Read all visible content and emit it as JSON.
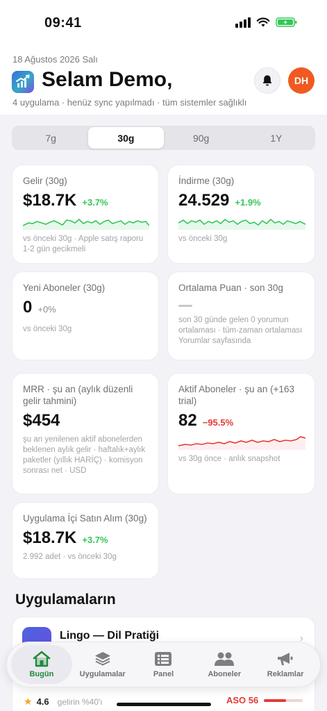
{
  "status_bar": {
    "time": "09:41"
  },
  "header": {
    "date": "18 Ağustos 2026 Salı",
    "greeting": "Selam Demo,",
    "subline": "4 uygulama · henüz sync yapılmadı · tüm sistemler sağlıklı",
    "avatar_initials": "DH"
  },
  "period_tabs": [
    {
      "label": "7g",
      "active": false
    },
    {
      "label": "30g",
      "active": true
    },
    {
      "label": "90g",
      "active": false
    },
    {
      "label": "1Y",
      "active": false
    }
  ],
  "cards": {
    "revenue": {
      "title": "Gelir (30g)",
      "value": "$18.7K",
      "delta": "+3.7%",
      "note": "vs önceki 30g · Apple satış raporu 1-2 gün gecikmeli"
    },
    "downloads": {
      "title": "İndirme (30g)",
      "value": "24.529",
      "delta": "+1.9%",
      "note": "vs önceki 30g"
    },
    "new_subs": {
      "title": "Yeni Aboneler (30g)",
      "value": "0",
      "delta": "+0%",
      "note": "vs önceki 30g"
    },
    "rating": {
      "title": "Ortalama Puan · son 30g",
      "note": "son 30 günde gelen 0 yorumun ortalaması · tüm-zaman ortalaması Yorumlar sayfasında"
    },
    "mrr": {
      "title": "MRR · şu an (aylık düzenli gelir tahmini)",
      "value": "$454",
      "note": "şu an yenilenen aktif abonelerden beklenen aylık gelir · haftalık+aylık paketler (yıllık HARİÇ) · komisyon sonrası net · USD"
    },
    "active_subs": {
      "title": "Aktif Aboneler · şu an (+163 trial)",
      "value": "82",
      "delta": "−95.5%",
      "note": "vs 30g önce · anlık snapshot"
    },
    "iap": {
      "title": "Uygulama İçi Satın Alım (30g)",
      "value": "$18.7K",
      "delta": "+3.7%",
      "note": "2.992 adet · vs önceki 30g"
    }
  },
  "colors": {
    "up": "#34c759",
    "down": "#e53935",
    "accent_orange": "#f05a22",
    "active_tab": "#1f8a3a"
  },
  "section": {
    "apps_title": "Uygulamaların"
  },
  "app_card": {
    "name": "Lingo — Dil Pratiği",
    "rating": "4.6",
    "rating_sub": "gelirin %40'ı",
    "aso_label": "ASO 56",
    "aso_score": 56
  },
  "tabbar": [
    {
      "label": "Bugün",
      "icon": "home-icon",
      "active": true
    },
    {
      "label": "Uygulamalar",
      "icon": "layers-icon",
      "active": false
    },
    {
      "label": "Panel",
      "icon": "panel-icon",
      "active": false
    },
    {
      "label": "Aboneler",
      "icon": "people-icon",
      "active": false
    },
    {
      "label": "Reklamlar",
      "icon": "megaphone-icon",
      "active": false
    }
  ]
}
